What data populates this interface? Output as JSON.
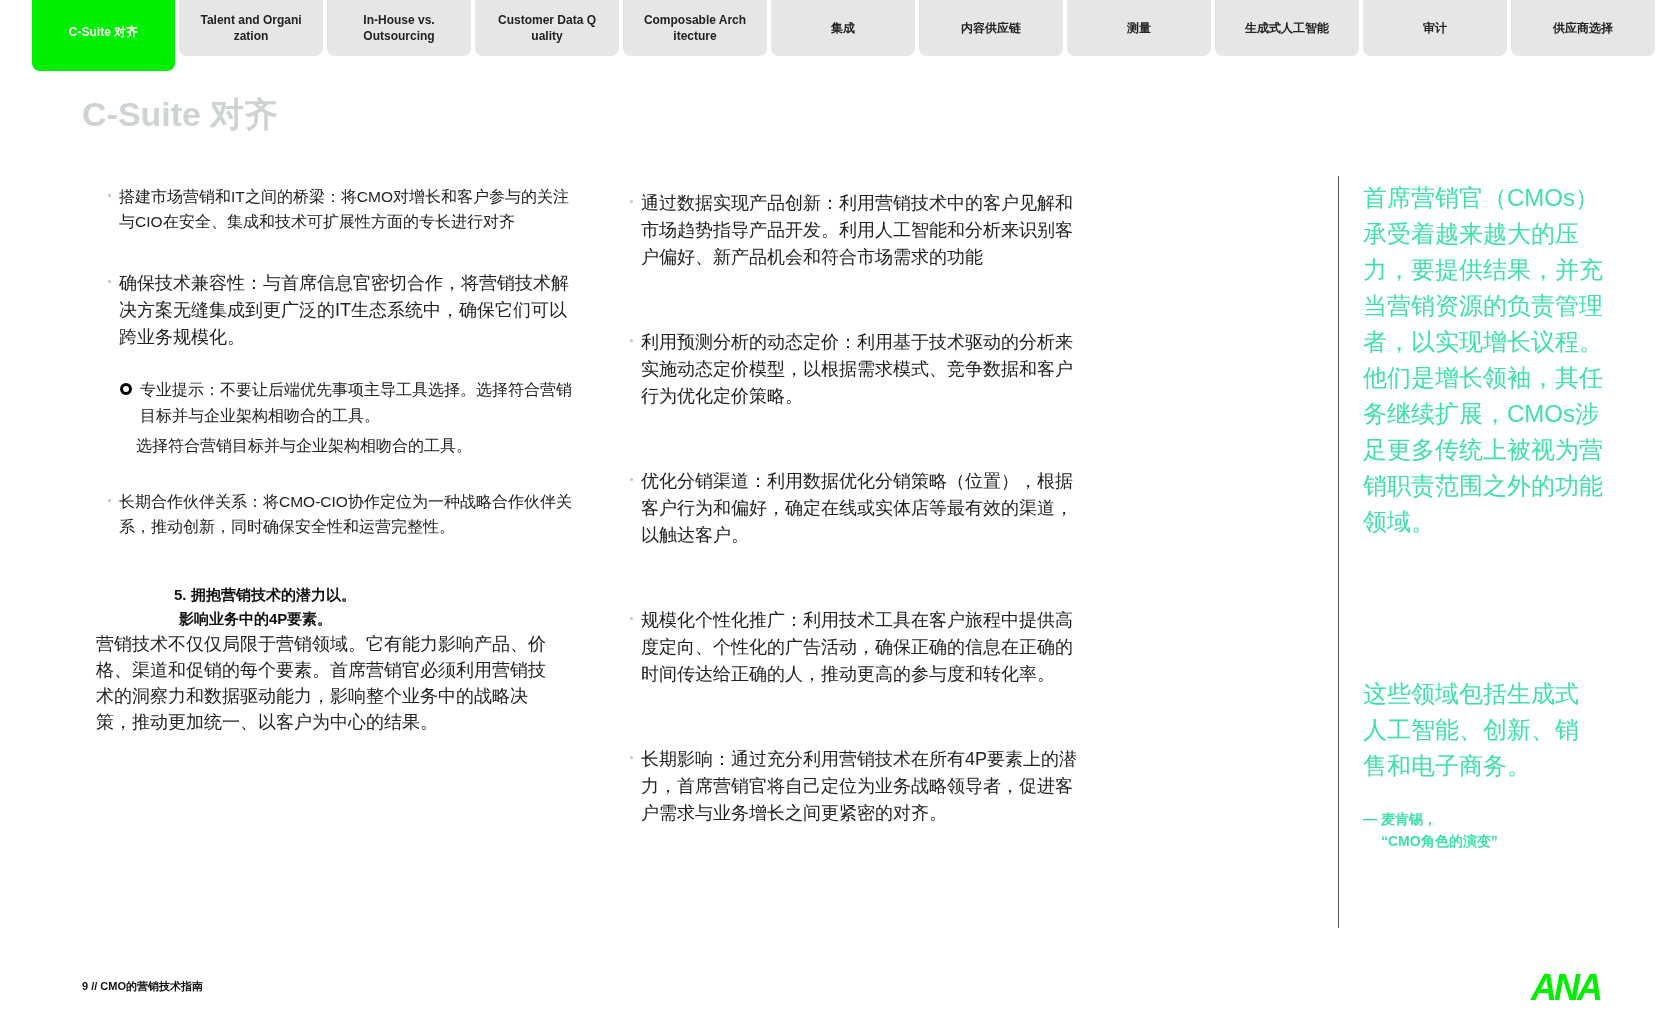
{
  "tabs": [
    {
      "label": "C-Suite 对齐",
      "selected": true
    },
    {
      "label": "Talent and Organi zation",
      "selected": false
    },
    {
      "label": "In-House vs. Outsourcing",
      "selected": false
    },
    {
      "label": "Customer Data Q uality",
      "selected": false
    },
    {
      "label": "Composable Arch itecture",
      "selected": false
    },
    {
      "label": "集成",
      "selected": false
    },
    {
      "label": "内容供应链",
      "selected": false
    },
    {
      "label": "测量",
      "selected": false
    },
    {
      "label": "生成式人工智能",
      "selected": false
    },
    {
      "label": "审计",
      "selected": false
    },
    {
      "label": "供应商选择",
      "selected": false
    }
  ],
  "page_title": "C-Suite 对齐",
  "left_column": {
    "items": [
      {
        "kind": "bullet",
        "text": "搭建市场营销和IT之间的桥梁：将CMO对增长和客户参与的关注与CIO在安全、集成和技术可扩展性方面的专长进行对齐"
      },
      {
        "kind": "bullet_large",
        "text": "确保技术兼容性：与首席信息官密切合作，将营销技术解决方案无缝集成到更广泛的IT生态系统中，确保它们可以跨业务规模化。"
      },
      {
        "kind": "tip",
        "text": "专业提示：不要让后端优先事项主导工具选择。选择符合营销目标并与企业架构相吻合的工具。",
        "text_2": "选择符合营销目标并与企业架构相吻合的工具。"
      },
      {
        "kind": "bullet",
        "text": "长期合作伙伴关系：将CMO-CIO协作定位为一种战略合作伙伴关系，推动创新，同时确保安全性和运营完整性。"
      }
    ],
    "section_heading": [
      "5. 拥抱营销技术的潜力以。",
      "影响业务中的4P要素。"
    ],
    "section_body": "营销技术不仅仅局限于营销领域。它有能力影响产品、价格、渠道和促销的每个要素。首席营销官必须利用营销技术的洞察力和数据驱动能力，影响整个业务中的战略决策，推动更加统一、以客户为中心的结果。"
  },
  "middle_column": {
    "items": [
      "通过数据实现产品创新：利用营销技术中的客户见解和市场趋势指导产品开发。利用人工智能和分析来识别客户偏好、新产品机会和符合市场需求的功能",
      "利用预测分析的动态定价：利用基于技术驱动的分析来实施动态定价模型，以根据需求模式、竞争数据和客户行为优化定价策略。",
      "优化分销渠道：利用数据优化分销策略（位置），根据客户行为和偏好，确定在线或实体店等最有效的渠道，以触达客户。",
      "规模化个性化推广：利用技术工具在客户旅程中提供高度定向、个性化的广告活动，确保正确的信息在正确的时间传达给正确的人，推动更高的参与度和转化率。",
      "长期影响：通过充分利用营销技术在所有4P要素上的潜力，首席营销官将自己定位为业务战略领导者，促进客户需求与业务增长之间更紧密的对齐。"
    ]
  },
  "sidebar": {
    "quote_1": "首席营销官（CMOs）承受着越来越大的压力，要提供结果，并充当营销资源的负责管理者，以实现增长议程。他们是增长领袖，其任务继续扩展，CMOs涉足更多传统上被视为营销职责范围之外的功能领域。",
    "quote_2": "这些领域包括生成式人工智能、创新、销售和电子商务。",
    "attribution": [
      "— 麦肯锡，",
      "“CMO角色的演变”"
    ]
  },
  "footer": {
    "page_label": "9 // CMO的营销技术指南",
    "logo": "ANA"
  }
}
